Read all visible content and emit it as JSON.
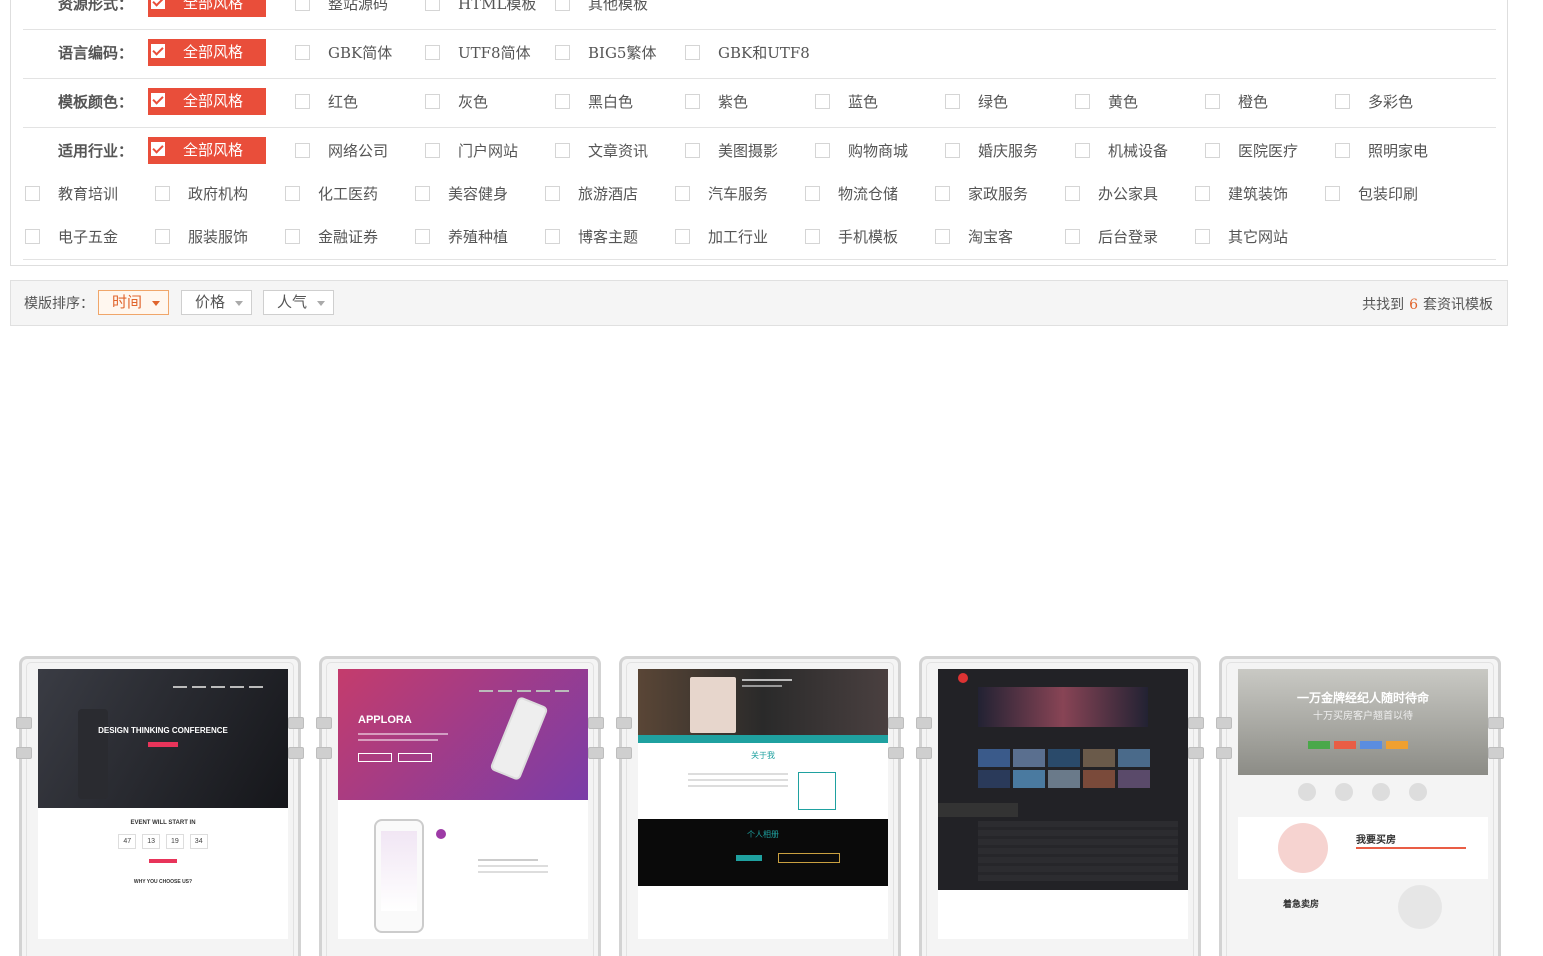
{
  "filters": [
    {
      "label": "资源形式：",
      "all": "全部风格",
      "options": [
        "整站源码",
        "HTML模板",
        "其他模板"
      ]
    },
    {
      "label": "语言编码：",
      "all": "全部风格",
      "options": [
        "GBK简体",
        "UTF8简体",
        "BIG5繁体",
        "GBK和UTF8"
      ]
    },
    {
      "label": "模板颜色：",
      "all": "全部风格",
      "options": [
        "红色",
        "灰色",
        "黑白色",
        "紫色",
        "蓝色",
        "绿色",
        "黄色",
        "橙色",
        "多彩色"
      ]
    },
    {
      "label": "适用行业：",
      "all": "全部风格",
      "options": [
        "网络公司",
        "门户网站",
        "文章资讯",
        "美图摄影",
        "购物商城",
        "婚庆服务",
        "机械设备",
        "医院医疗",
        "照明家电"
      ],
      "more_rows": [
        [
          "教育培训",
          "政府机构",
          "化工医药",
          "美容健身",
          "旅游酒店",
          "汽车服务",
          "物流仓储",
          "家政服务",
          "办公家具",
          "建筑装饰",
          "包装印刷"
        ],
        [
          "电子五金",
          "服装服饰",
          "金融证券",
          "养殖种植",
          "博客主题",
          "加工行业",
          "手机模板",
          "淘宝客",
          "后台登录",
          "其它网站"
        ]
      ]
    }
  ],
  "sort": {
    "label": "模版排序：",
    "buttons": [
      "时间",
      "价格",
      "人气"
    ],
    "active": 0
  },
  "result": {
    "prefix": "共找到",
    "count": "6",
    "suffix": "套资讯模板"
  },
  "thumbs": [
    {
      "hero_title": "DESIGN THINKING CONFERENCE",
      "heading": "EVENT WILL START IN",
      "counters": [
        "47",
        "13",
        "19",
        "34"
      ],
      "sub": "WHY YOU CHOOSE US?",
      "colors": {
        "top": "#1e1f24",
        "accent": "#e8345a"
      }
    },
    {
      "hero_title": "APPLORA",
      "colors": {
        "top": "#b0356f",
        "accent": "#8a3fb2"
      }
    },
    {
      "hero_title": "关于我",
      "sub": "个人相册",
      "colors": {
        "top": "#2b2b2b",
        "accent": "#1fa1a0"
      }
    },
    {
      "colors": {
        "top": "#2a2a2e",
        "accent": "#d33"
      }
    },
    {
      "hero_title": "一万金牌经纪人随时待命",
      "hero_sub": "十万买房客户翘首以待",
      "section1": "我要买房",
      "section2": "着急卖房",
      "colors": {
        "top": "#9a9a94",
        "accent": "#e95d45"
      }
    }
  ]
}
